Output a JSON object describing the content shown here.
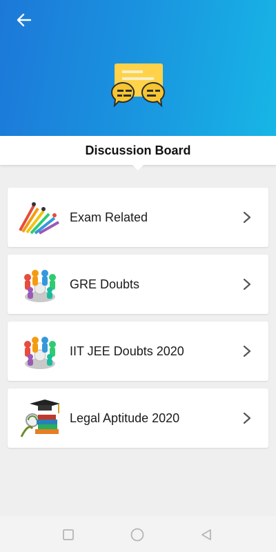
{
  "colors": {
    "header_start": "#1c78d8",
    "header_end": "#17b6e6",
    "icon_yellow": "#ffcf3d",
    "card_bg": "#ffffff",
    "page_bg": "#efefef"
  },
  "header": {
    "back_icon": "arrow-left-icon",
    "hero_icon": "chat-bubbles-icon"
  },
  "title": "Discussion Board",
  "boards": [
    {
      "label": "Exam Related",
      "icon": "runners-race-icon"
    },
    {
      "label": "GRE Doubts",
      "icon": "people-group-icon"
    },
    {
      "label": "IIT JEE Doubts 2020",
      "icon": "people-group-icon"
    },
    {
      "label": "Legal Aptitude 2020",
      "icon": "graduation-books-icon"
    }
  ],
  "navbar": {
    "recents_icon": "square-icon",
    "home_icon": "circle-icon",
    "back_icon": "triangle-back-icon"
  }
}
